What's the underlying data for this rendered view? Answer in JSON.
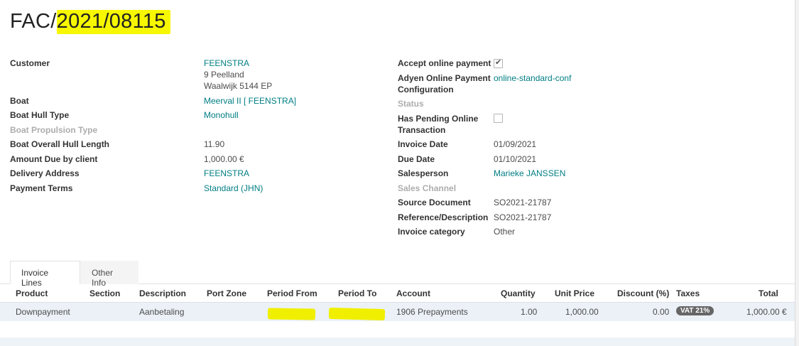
{
  "invoice": {
    "prefix": "FAC/",
    "number": "2021/08115"
  },
  "left_fields": {
    "customer": {
      "label": "Customer",
      "name": "FEENSTRA",
      "address_line1": "9 Peelland",
      "address_line2": "Waalwijk 5144 EP"
    },
    "boat": {
      "label": "Boat",
      "value": "Meerval II [ FEENSTRA]"
    },
    "hull_type": {
      "label": "Boat Hull Type",
      "value": "Monohull"
    },
    "propulsion": {
      "label": "Boat Propulsion Type",
      "value": ""
    },
    "hull_length": {
      "label": "Boat Overall Hull Length",
      "value": "11.90"
    },
    "amount_due": {
      "label": "Amount Due by client",
      "value": "1,000.00 €"
    },
    "delivery": {
      "label": "Delivery Address",
      "value": "FEENSTRA"
    },
    "payment_terms": {
      "label": "Payment Terms",
      "value": "Standard (JHN)"
    }
  },
  "right_fields": {
    "accept_online": {
      "label": "Accept online payment",
      "checked": true
    },
    "adyen": {
      "label_line1": "Adyen Online Payment",
      "label_line2": "Configuration",
      "value": "online-standard-conf"
    },
    "status": {
      "label": "Status",
      "value": ""
    },
    "pending": {
      "label_line1": "Has Pending Online",
      "label_line2": "Transaction",
      "checked": false
    },
    "invoice_date": {
      "label": "Invoice Date",
      "value": "01/09/2021"
    },
    "due_date": {
      "label": "Due Date",
      "value": "01/10/2021"
    },
    "salesperson": {
      "label": "Salesperson",
      "value": "Marieke JANSSEN"
    },
    "sales_channel": {
      "label": "Sales Channel",
      "value": ""
    },
    "source_doc": {
      "label": "Source Document",
      "value": "SO2021-21787"
    },
    "reference": {
      "label": "Reference/Description",
      "value": "SO2021-21787"
    },
    "category": {
      "label": "Invoice category",
      "value": "Other"
    }
  },
  "tabs": [
    {
      "label": "Invoice Lines",
      "active": true
    },
    {
      "label": "Other Info",
      "active": false
    }
  ],
  "table": {
    "headers": [
      "Product",
      "Section",
      "Description",
      "Port Zone",
      "Period From",
      "Period To",
      "Account",
      "Quantity",
      "Unit Price",
      "Discount (%)",
      "Taxes",
      "Total"
    ],
    "rows": [
      {
        "product": "Downpayment",
        "section": "",
        "description": "Aanbetaling",
        "port_zone": "",
        "period_from": "",
        "period_to": "",
        "account": "1906 Prepayments",
        "quantity": "1.00",
        "unit_price": "1,000.00",
        "discount": "0.00",
        "tax": "VAT 21%",
        "total": "1,000.00 €"
      }
    ]
  },
  "colors": {
    "link": "#017e84",
    "highlight": "#f7f700",
    "row_bg": "#ebf1f7",
    "badge": "#666666"
  }
}
